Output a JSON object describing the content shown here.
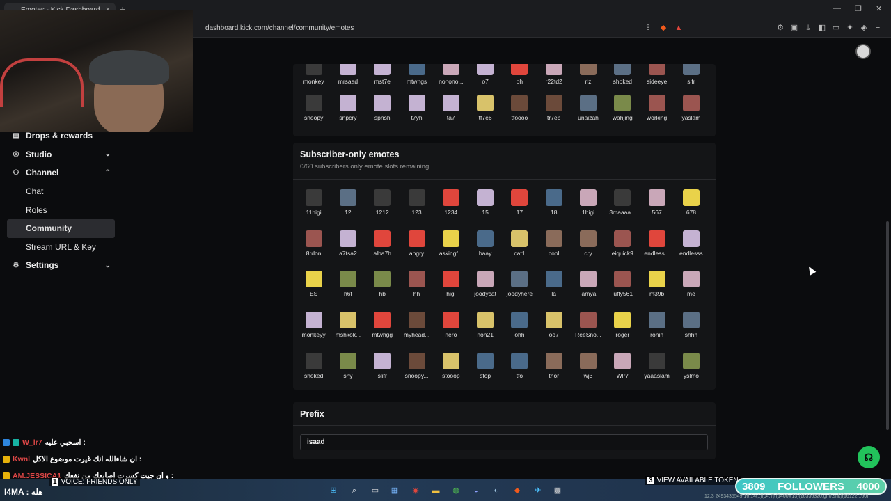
{
  "browser": {
    "tab_title": "Emotes - Kick Dashboard",
    "tab_close": "×",
    "new_tab": "+",
    "url": "dashboard.kick.com/channel/community/emotes",
    "window_controls": [
      "—",
      "❐",
      "✕"
    ]
  },
  "sidebar": {
    "items": [
      {
        "label": "Drops & rewards",
        "icon": "gift-icon",
        "chevron": ""
      },
      {
        "label": "Studio",
        "icon": "studio-icon",
        "chevron": "⌄"
      },
      {
        "label": "Channel",
        "icon": "channel-icon",
        "chevron": "⌃"
      },
      {
        "label": "Chat",
        "sub": true
      },
      {
        "label": "Roles",
        "sub": true
      },
      {
        "label": "Community",
        "sub": true,
        "active": true
      },
      {
        "label": "Stream URL & Key",
        "sub": true
      },
      {
        "label": "Settings",
        "icon": "gear-icon",
        "chevron": "⌄"
      }
    ]
  },
  "top_emotes": {
    "row1": [
      "monkey",
      "mrsaad",
      "mst7e",
      "mtwhgs",
      "nonono...",
      "o7",
      "oh",
      "r22td2",
      "riz",
      "shoked",
      "sideeye",
      "slfr"
    ],
    "row2": [
      "snoopy",
      "snpcry",
      "spnsh",
      "t7yh",
      "ta7",
      "tf7e6",
      "tfoooo",
      "tr7eb",
      "unaizah",
      "wahjing",
      "working",
      "yaslam"
    ]
  },
  "subscriber": {
    "title": "Subscriber-only emotes",
    "description": "0/60 subscribers only emote slots remaining",
    "rows": [
      [
        "11higi",
        "12",
        "1212",
        "123",
        "1234",
        "15",
        "17",
        "18",
        "1higi",
        "3maaaa...",
        "567",
        "678"
      ],
      [
        "8rdon",
        "a7tsa2",
        "alba7h",
        "angry",
        "askingf...",
        "baay",
        "cat1",
        "cool",
        "cry",
        "eiquick9",
        "endless...",
        "endlesss"
      ],
      [
        "ES",
        "h6f",
        "hb",
        "hh",
        "higi",
        "joodycat",
        "joodyhere",
        "la",
        "lamya",
        "luffy561",
        "m39b",
        "me"
      ],
      [
        "monkeyy",
        "mshkok...",
        "mtwhgg",
        "myhead...",
        "nero",
        "non21",
        "ohh",
        "oo7",
        "ReeSno...",
        "roger",
        "ronin",
        "shhh"
      ],
      [
        "shoked",
        "shy",
        "slifr",
        "snoopy...",
        "stooop",
        "stop",
        "tfo",
        "thor",
        "wj3",
        "Wlr7",
        "yaaaslam",
        "yslmo"
      ]
    ]
  },
  "prefix": {
    "title": "Prefix",
    "value": "isaad"
  },
  "chat": [
    {
      "user": "W_lr7",
      "msg": "اسحبي عليه :"
    },
    {
      "user": "Kwnl",
      "msg": "ان شاءالله انك غيرت موضوع الاكل :"
    },
    {
      "user": "AM.JESSICA1",
      "msg": "و ان جبت كسرت اصابعك من نفعك :"
    }
  ],
  "overlay": {
    "voice_num": "1",
    "voice_text": "VOICE: FRIENDS ONLY",
    "name": "I4MA : هله",
    "tokens_num": "3",
    "tokens_text": "VIEW AVAILABLE TOKEN",
    "followers_count": "3809",
    "followers_label": "FOLLOWERS",
    "followers_goal": "4000",
    "faint_text": "12.3 2493435549 16.14(1)(04:7) (1400)(13)(16336320.gr.0.snk)(16122.160)"
  },
  "colors": {
    "accent": "#53fc18",
    "help": "#22c35b",
    "chat_user": "#e04747"
  }
}
